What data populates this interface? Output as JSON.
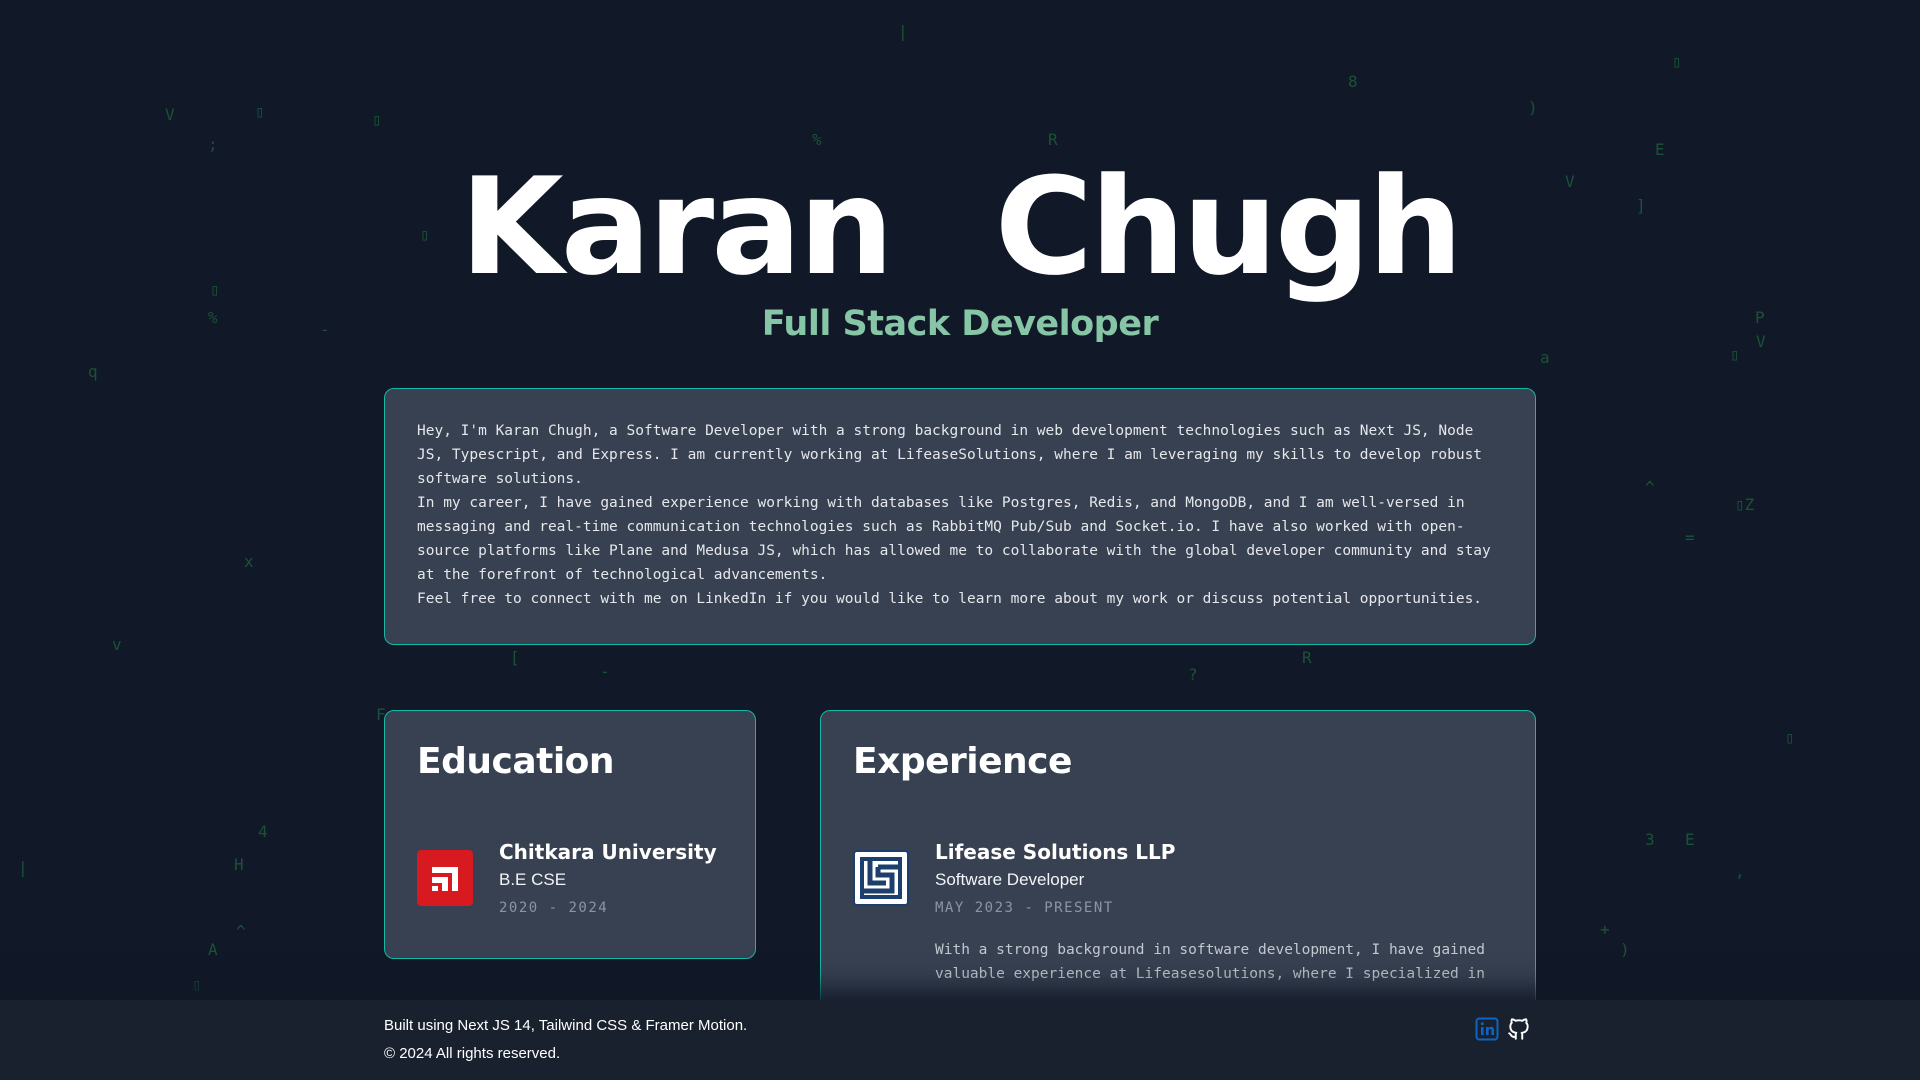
{
  "hero": {
    "name": "Karan Chugh",
    "role": "Full Stack Developer"
  },
  "about": {
    "paragraphs": [
      "Hey, I'm Karan Chugh, a Software Developer with a strong background in web development technologies such as Next JS, Node JS, Typescript, and Express. I am currently working at LifeaseSolutions, where I am leveraging my skills to develop robust software solutions.",
      "In my career, I have gained experience working with databases like Postgres, Redis, and MongoDB, and I am well-versed in messaging and real-time communication technologies such as RabbitMQ Pub/Sub and Socket.io. I have also worked with open-source platforms like Plane and Medusa JS, which has allowed me to collaborate with the global developer community and stay at the forefront of technological advancements.",
      "Feel free to connect with me on LinkedIn if you would like to learn more about my work or discuss potential opportunities."
    ]
  },
  "education": {
    "title": "Education",
    "institution": "Chitkara University",
    "degree": "B.E CSE",
    "dates": "2020 - 2024",
    "logo_icon": "chitkara-logo-icon",
    "logo_color": "#d71920"
  },
  "experience": {
    "title": "Experience",
    "company": "Lifease Solutions LLP",
    "role": "Software Developer",
    "dates": "MAY 2023 - PRESENT",
    "description": "With a strong background in software development, I have gained valuable experience at Lifeasesolutions, where I specialized in",
    "logo_icon": "lifease-logo-icon",
    "logo_color": "#1d3f6e"
  },
  "footer": {
    "built_with": "Built using Next JS 14, Tailwind CSS & Framer Motion.",
    "copyright": "© 2024 All rights reserved.",
    "links": [
      {
        "icon": "linkedin-icon",
        "color": "#0a66c2"
      },
      {
        "icon": "github-icon",
        "color": "#ffffff"
      }
    ]
  },
  "theme": {
    "background": "#111827",
    "card": "#374151",
    "accent_border": "#14b8a6",
    "role_color": "#86c5a6",
    "matrix_glyph_color": "#1f6b3e"
  }
}
